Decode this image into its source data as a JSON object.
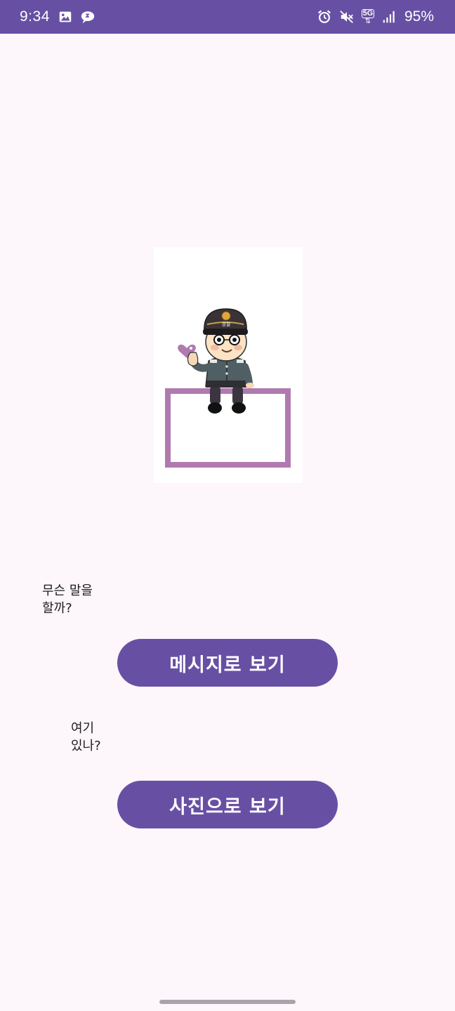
{
  "status_bar": {
    "time": "9:34",
    "network": "5G",
    "battery": "95%",
    "left_icons": [
      "image-icon",
      "chat-bubble-icon"
    ],
    "right_icons": [
      "alarm-icon",
      "mute-icon",
      "5g-network-icon",
      "signal-icon"
    ],
    "color": "#6750A4"
  },
  "character": {
    "cap_badge_text": "경찰",
    "accent_color": "#B07AAF"
  },
  "prompts": {
    "message": "무슨 말을\n할까?",
    "photo": "여기\n있나?"
  },
  "buttons": {
    "view_message": "메시지로 보기",
    "view_photo": "사진으로 보기",
    "color": "#6750A4"
  }
}
